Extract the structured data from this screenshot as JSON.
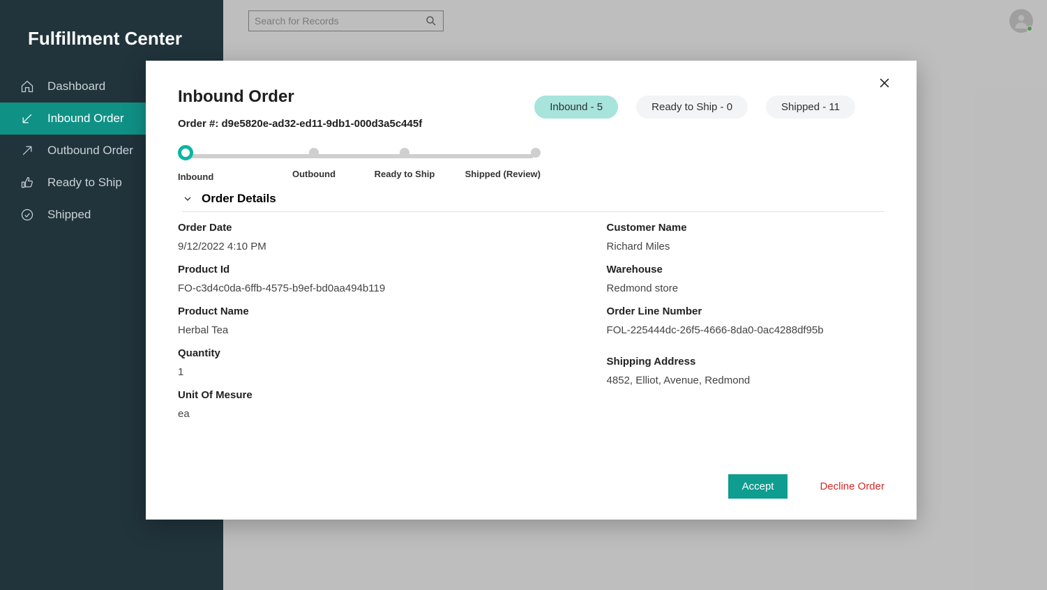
{
  "app_title": "Fulfillment Center",
  "sidebar": {
    "items": [
      {
        "label": "Dashboard"
      },
      {
        "label": "Inbound Order"
      },
      {
        "label": "Outbound Order"
      },
      {
        "label": "Ready to Ship"
      },
      {
        "label": "Shipped"
      }
    ]
  },
  "search": {
    "placeholder": "Search for Records"
  },
  "modal": {
    "title": "Inbound Order",
    "order_number_label": "Order #: d9e5820e-ad32-ed11-9db1-000d3a5c445f",
    "chips": {
      "inbound": "Inbound - 5",
      "ready": "Ready to Ship - 0",
      "shipped": "Shipped - 11"
    },
    "steps": {
      "inbound": "Inbound",
      "outbound": "Outbound",
      "ready": "Ready to Ship",
      "shipped": "Shipped (Review)"
    },
    "section_title": "Order Details",
    "fields": {
      "order_date_lbl": "Order Date",
      "order_date": "9/12/2022 4:10 PM",
      "product_id_lbl": "Product Id",
      "product_id": "FO-c3d4c0da-6ffb-4575-b9ef-bd0aa494b119",
      "product_name_lbl": "Product Name",
      "product_name": "Herbal Tea",
      "quantity_lbl": "Quantity",
      "quantity": "1",
      "uom_lbl": "Unit Of Mesure",
      "uom": "ea",
      "customer_lbl": "Customer Name",
      "customer": "Richard Miles",
      "warehouse_lbl": "Warehouse",
      "warehouse": "Redmond store",
      "oln_lbl": "Order Line Number",
      "oln": "FOL-225444dc-26f5-4666-8da0-0ac4288df95b",
      "ship_addr_lbl": "Shipping Address",
      "ship_addr": "4852, Elliot, Avenue, Redmond"
    },
    "buttons": {
      "accept": "Accept",
      "decline": "Decline Order"
    }
  }
}
